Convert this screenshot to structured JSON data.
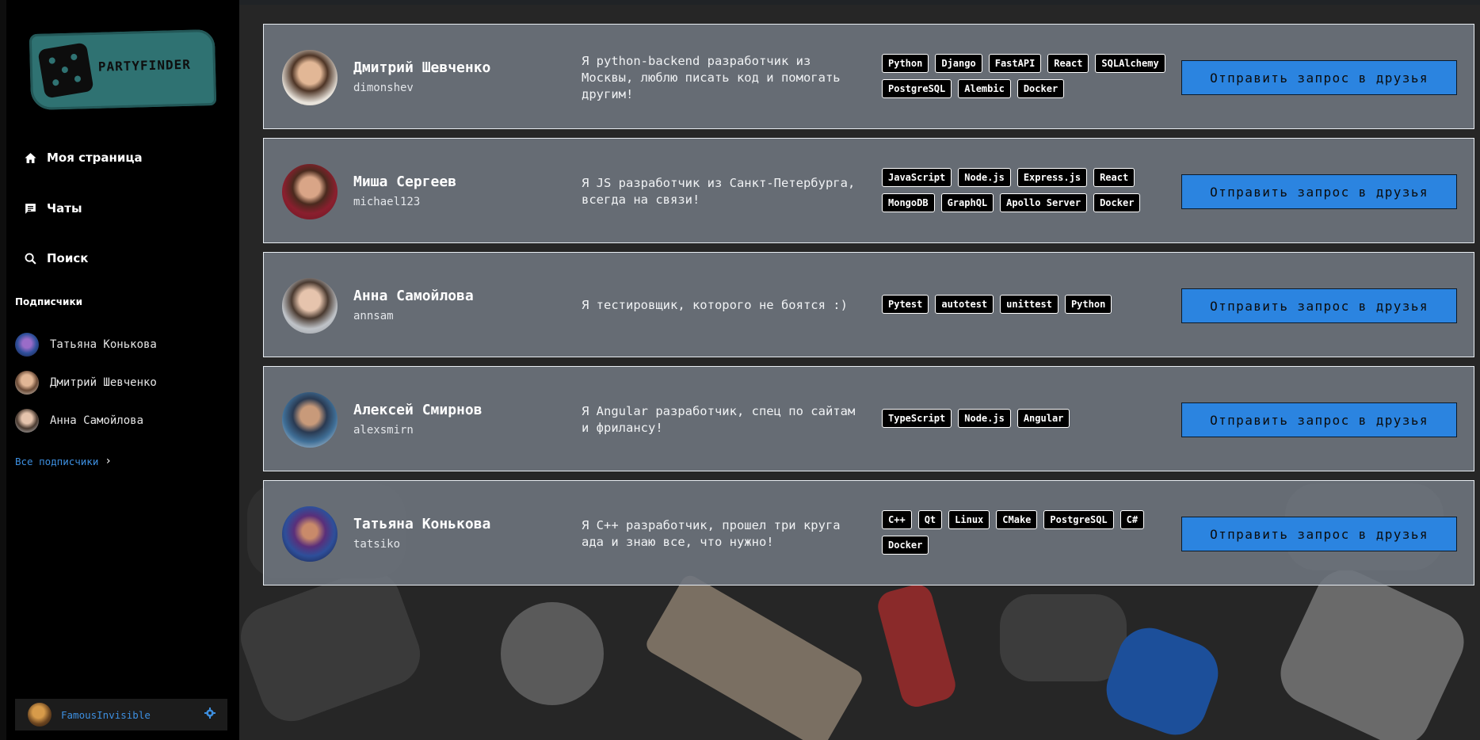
{
  "app": {
    "logo_text": "PARTYFINDER"
  },
  "nav": [
    {
      "label": "Моя страница",
      "icon": "home-icon"
    },
    {
      "label": "Чаты",
      "icon": "chat-icon"
    },
    {
      "label": "Поиск",
      "icon": "search-icon"
    }
  ],
  "subscribers": {
    "title": "Подписчики",
    "items": [
      {
        "name": "Татьяна Конькова"
      },
      {
        "name": "Дмитрий Шевченко"
      },
      {
        "name": "Анна Самойлова"
      }
    ],
    "all_link": "Все подписчики"
  },
  "current_user": {
    "name": "FamousInvisible"
  },
  "users": [
    {
      "full_name": "Дмитрий Шевченко",
      "username": "dimonshev",
      "bio": "Я python-backend разработчик из Москвы, люблю писать код и помогать другим!",
      "tags": [
        "Python",
        "Django",
        "FastAPI",
        "React",
        "SQLAlchemy",
        "PostgreSQL",
        "Alembic",
        "Docker"
      ],
      "button": "Отправить запрос в друзья"
    },
    {
      "full_name": "Миша Сергеев",
      "username": "michael123",
      "bio": "Я JS разработчик из Санкт-Петербурга, всегда на связи!",
      "tags": [
        "JavaScript",
        "Node.js",
        "Express.js",
        "React",
        "MongoDB",
        "GraphQL",
        "Apollo Server",
        "Docker"
      ],
      "button": "Отправить запрос в друзья"
    },
    {
      "full_name": "Анна Самойлова",
      "username": "annsam",
      "bio": "Я тестировщик, которого не боятся :)",
      "tags": [
        "Pytest",
        "autotest",
        "unittest",
        "Python"
      ],
      "button": "Отправить запрос в друзья"
    },
    {
      "full_name": "Алексей Смирнов",
      "username": "alexsmirn",
      "bio": "Я Angular разработчик, спец по сайтам и фрилансу!",
      "tags": [
        "TypeScript",
        "Node.js",
        "Angular"
      ],
      "button": "Отправить запрос в друзья"
    },
    {
      "full_name": "Татьяна Конькова",
      "username": "tatsiko",
      "bio": "Я C++ разработчик, прошел три круга ада и знаю все, что нужно!",
      "tags": [
        "C++",
        "Qt",
        "Linux",
        "CMake",
        "PostgreSQL",
        "C#",
        "Docker"
      ],
      "button": "Отправить запрос в друзья"
    }
  ],
  "colors": {
    "accent": "#2b84e0",
    "link": "#3d8fe0",
    "logo": "#2f7272",
    "sidebar": "#000000"
  }
}
